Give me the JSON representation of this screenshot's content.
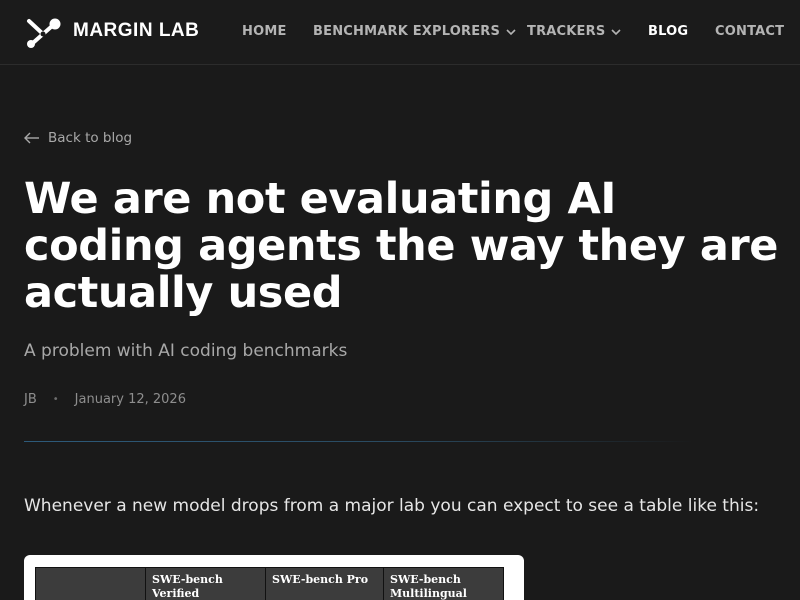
{
  "header": {
    "brand": "MARGIN LAB",
    "nav": [
      {
        "label": "HOME"
      },
      {
        "label": "BENCHMARK EXPLORERS"
      },
      {
        "label": "TRACKERS"
      },
      {
        "label": "BLOG"
      },
      {
        "label": "CONTACT"
      }
    ]
  },
  "back_link": "Back to blog",
  "article": {
    "title": "We are not evaluating AI coding agents the way they are actually used",
    "subtitle": "A problem with AI coding benchmarks",
    "author": "JB",
    "separator": "•",
    "date": "January 12, 2026",
    "intro": "Whenever a new model drops from a major lab you can expect to see a table like this:"
  },
  "figure": {
    "headers": [
      "",
      "SWE-bench Verified",
      "SWE-bench Pro",
      "SWE-bench Multilingual"
    ]
  },
  "colors": {
    "background": "#1a1a1a",
    "text": "#ffffff",
    "muted": "#a8a8a8",
    "divider": "#2d5a7a"
  },
  "icons": {
    "logo": "margin-lab-logo-icon",
    "back": "arrow-left-icon",
    "dropdown": "chevron-down-icon"
  }
}
